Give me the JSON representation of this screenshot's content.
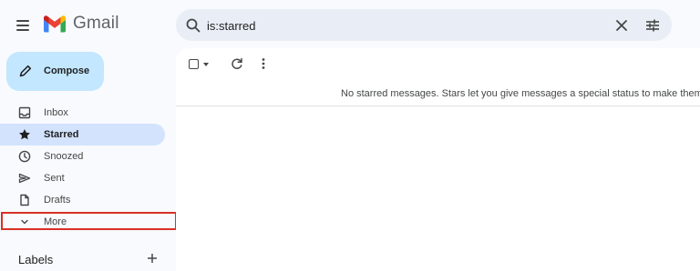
{
  "app": {
    "name": "Gmail"
  },
  "search": {
    "query": "is:starred"
  },
  "compose": {
    "label": "Compose"
  },
  "sidebar": {
    "items": [
      {
        "label": "Inbox"
      },
      {
        "label": "Starred"
      },
      {
        "label": "Snoozed"
      },
      {
        "label": "Sent"
      },
      {
        "label": "Drafts"
      },
      {
        "label": "More"
      }
    ],
    "labels_title": "Labels"
  },
  "main": {
    "empty_message": "No starred messages. Stars let you give messages a special status to make them"
  },
  "colors": {
    "accent": "#c2e7ff",
    "active_item": "#d3e3fd",
    "highlight": "#d93025"
  }
}
